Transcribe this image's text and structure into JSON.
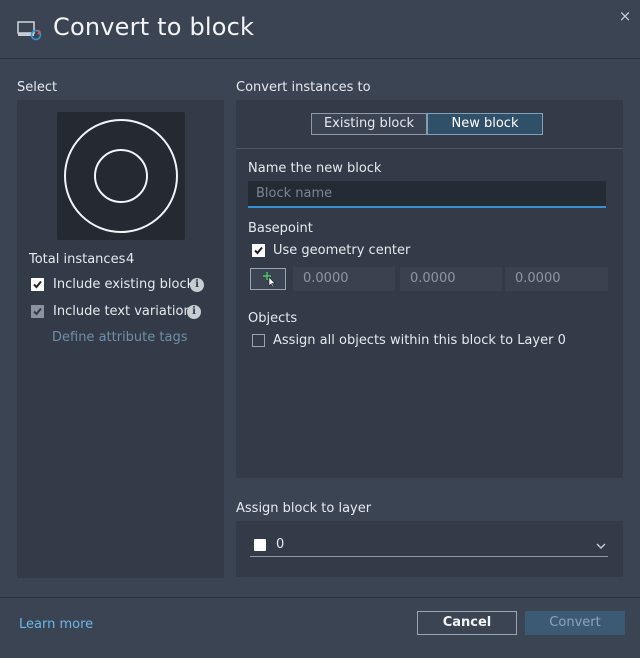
{
  "window": {
    "title": "Convert to block",
    "icon": "convert-block-icon",
    "close_glyph": "×"
  },
  "select_section": {
    "label": "Select",
    "total_instances_label": "Total instances",
    "total_instances_value": "4",
    "include_existing_label": "Include existing blocks",
    "include_existing_checked": true,
    "include_text_label": "Include text variations",
    "include_text_checked": true,
    "include_text_disabled": true,
    "define_tags_label": "Define attribute tags",
    "info_glyph": "i"
  },
  "convert_section": {
    "label": "Convert instances to",
    "tabs": [
      {
        "label": "Existing block",
        "selected": false
      },
      {
        "label": "New block",
        "selected": true
      }
    ],
    "name_label": "Name the new block",
    "name_placeholder": "Block name",
    "name_value": "",
    "basepoint_label": "Basepoint",
    "use_geometry_label": "Use geometry center",
    "use_geometry_checked": true,
    "coords": [
      "0.0000",
      "0.0000",
      "0.0000"
    ],
    "objects_label": "Objects",
    "assign_layer0_label": "Assign all objects within this block to Layer 0",
    "assign_layer0_checked": false
  },
  "layer_section": {
    "label": "Assign block to layer",
    "selected_layer": "0",
    "swatch_color": "#ffffff"
  },
  "footer": {
    "learn_more": "Learn more",
    "cancel": "Cancel",
    "convert": "Convert"
  },
  "colors": {
    "background": "#3b4453",
    "panel": "#333b48",
    "accent": "#3a8fd0",
    "link": "#6fb6ec",
    "selected_tab": "#2f5068"
  }
}
